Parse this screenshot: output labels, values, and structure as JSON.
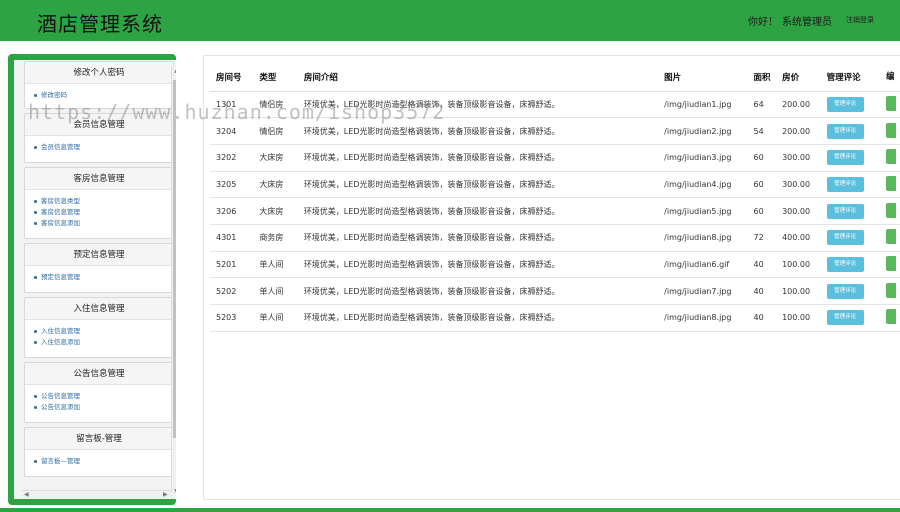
{
  "header": {
    "title": "酒店管理系统",
    "greeting": "你好！",
    "user": "系统管理员",
    "logout": "注销登录",
    "color": "#2ea343"
  },
  "sidebar": {
    "panels": [
      {
        "title": "修改个人密码",
        "links": [
          "修改密码"
        ]
      },
      {
        "title": "会员信息管理",
        "links": [
          "会员信息管理"
        ]
      },
      {
        "title": "客房信息管理",
        "links": [
          "客房信息类型",
          "客房信息管理",
          "客房信息添加"
        ]
      },
      {
        "title": "预定信息管理",
        "links": [
          "预定信息管理"
        ]
      },
      {
        "title": "入住信息管理",
        "links": [
          "入住信息管理",
          "入住信息添加"
        ]
      },
      {
        "title": "公告信息管理",
        "links": [
          "公告信息管理",
          "公告信息添加"
        ]
      },
      {
        "title": "留言板-管理",
        "links": [
          "留言板—管理"
        ]
      }
    ]
  },
  "table": {
    "headers": [
      "房间号",
      "类型",
      "房间介绍",
      "图片",
      "面积",
      "房价",
      "管理评论",
      "编"
    ],
    "review_button": "管理评论",
    "rows": [
      {
        "no": "1301",
        "type": "情侣房",
        "desc": "环境优美，LED光影时尚造型格调装饰，装备顶级影音设备，床褥舒适。",
        "img": "/img/jiudian1.jpg",
        "area": "64",
        "price": "200.00"
      },
      {
        "no": "3204",
        "type": "情侣房",
        "desc": "环境优美，LED光影时尚造型格调装饰，装备顶级影音设备，床褥舒适。",
        "img": "/img/jiudian2.jpg",
        "area": "54",
        "price": "200.00"
      },
      {
        "no": "3202",
        "type": "大床房",
        "desc": "环境优美，LED光影时尚造型格调装饰，装备顶级影音设备，床褥舒适。",
        "img": "/img/jiudian3.jpg",
        "area": "60",
        "price": "300.00"
      },
      {
        "no": "3205",
        "type": "大床房",
        "desc": "环境优美，LED光影时尚造型格调装饰，装备顶级影音设备，床褥舒适。",
        "img": "/img/jiudian4.jpg",
        "area": "60",
        "price": "300.00"
      },
      {
        "no": "3206",
        "type": "大床房",
        "desc": "环境优美，LED光影时尚造型格调装饰，装备顶级影音设备，床褥舒适。",
        "img": "/img/jiudian5.jpg",
        "area": "60",
        "price": "300.00"
      },
      {
        "no": "4301",
        "type": "商务房",
        "desc": "环境优美，LED光影时尚造型格调装饰，装备顶级影音设备，床褥舒适。",
        "img": "/img/jiudian8.jpg",
        "area": "72",
        "price": "400.00"
      },
      {
        "no": "5201",
        "type": "单人间",
        "desc": "环境优美，LED光影时尚造型格调装饰，装备顶级影音设备，床褥舒适。",
        "img": "/img/jiudian6.gif",
        "area": "40",
        "price": "100.00"
      },
      {
        "no": "5202",
        "type": "单人间",
        "desc": "环境优美，LED光影时尚造型格调装饰，装备顶级影音设备，床褥舒适。",
        "img": "/img/jiudian7.jpg",
        "area": "40",
        "price": "100.00"
      },
      {
        "no": "5203",
        "type": "单人间",
        "desc": "环境优美，LED光影时尚造型格调装饰，装备顶级影音设备，床褥舒适。",
        "img": "/img/jiudian8.jpg",
        "area": "40",
        "price": "100.00"
      }
    ]
  },
  "watermark": "https://www.huzhan.com/ishop3572"
}
